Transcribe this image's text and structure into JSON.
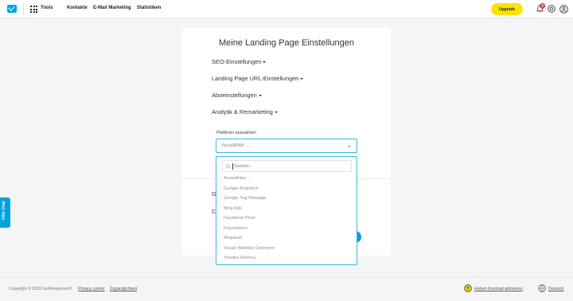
{
  "topbar": {
    "tools_label": "Tools",
    "nav": [
      "Kontakte",
      "E-Mail Marketing",
      "Statistiken"
    ],
    "upgrade_label": "Upgrade",
    "notification_count": "2"
  },
  "page": {
    "title": "Meine Landing Page Einstellungen",
    "sections": [
      "SEO-Einstellungen",
      "Landing Page URL-Einstellungen",
      "Aboeinstellungen",
      "Analytik & Remarketing"
    ],
    "hidden_rows": [
      "G",
      "C"
    ]
  },
  "platform": {
    "label": "Plattform auswählen",
    "selected": "Auswählen ...",
    "search_placeholder": "Suchen...",
    "options": [
      "Auswählen ...",
      "Google Analytics",
      "Google Tag Manager",
      "Bing Ads",
      "Facebook Pixel",
      "Kissmetrics",
      "Mixpanel",
      "Visual Website Optimizer",
      "Yandex Metrica"
    ]
  },
  "feedback_tab": "Hilfe Chat",
  "footer": {
    "copyright": "Copyright © 2022 GetResponse®",
    "privacy": "Privacy center",
    "accessibility": "Zugänglichkeit",
    "contrast": "Hohen Kontrast aktivieren",
    "language": "Deutsch"
  },
  "colors": {
    "accent": "#00a2e0",
    "upgrade": "#fce300",
    "badge": "#e0322c"
  }
}
